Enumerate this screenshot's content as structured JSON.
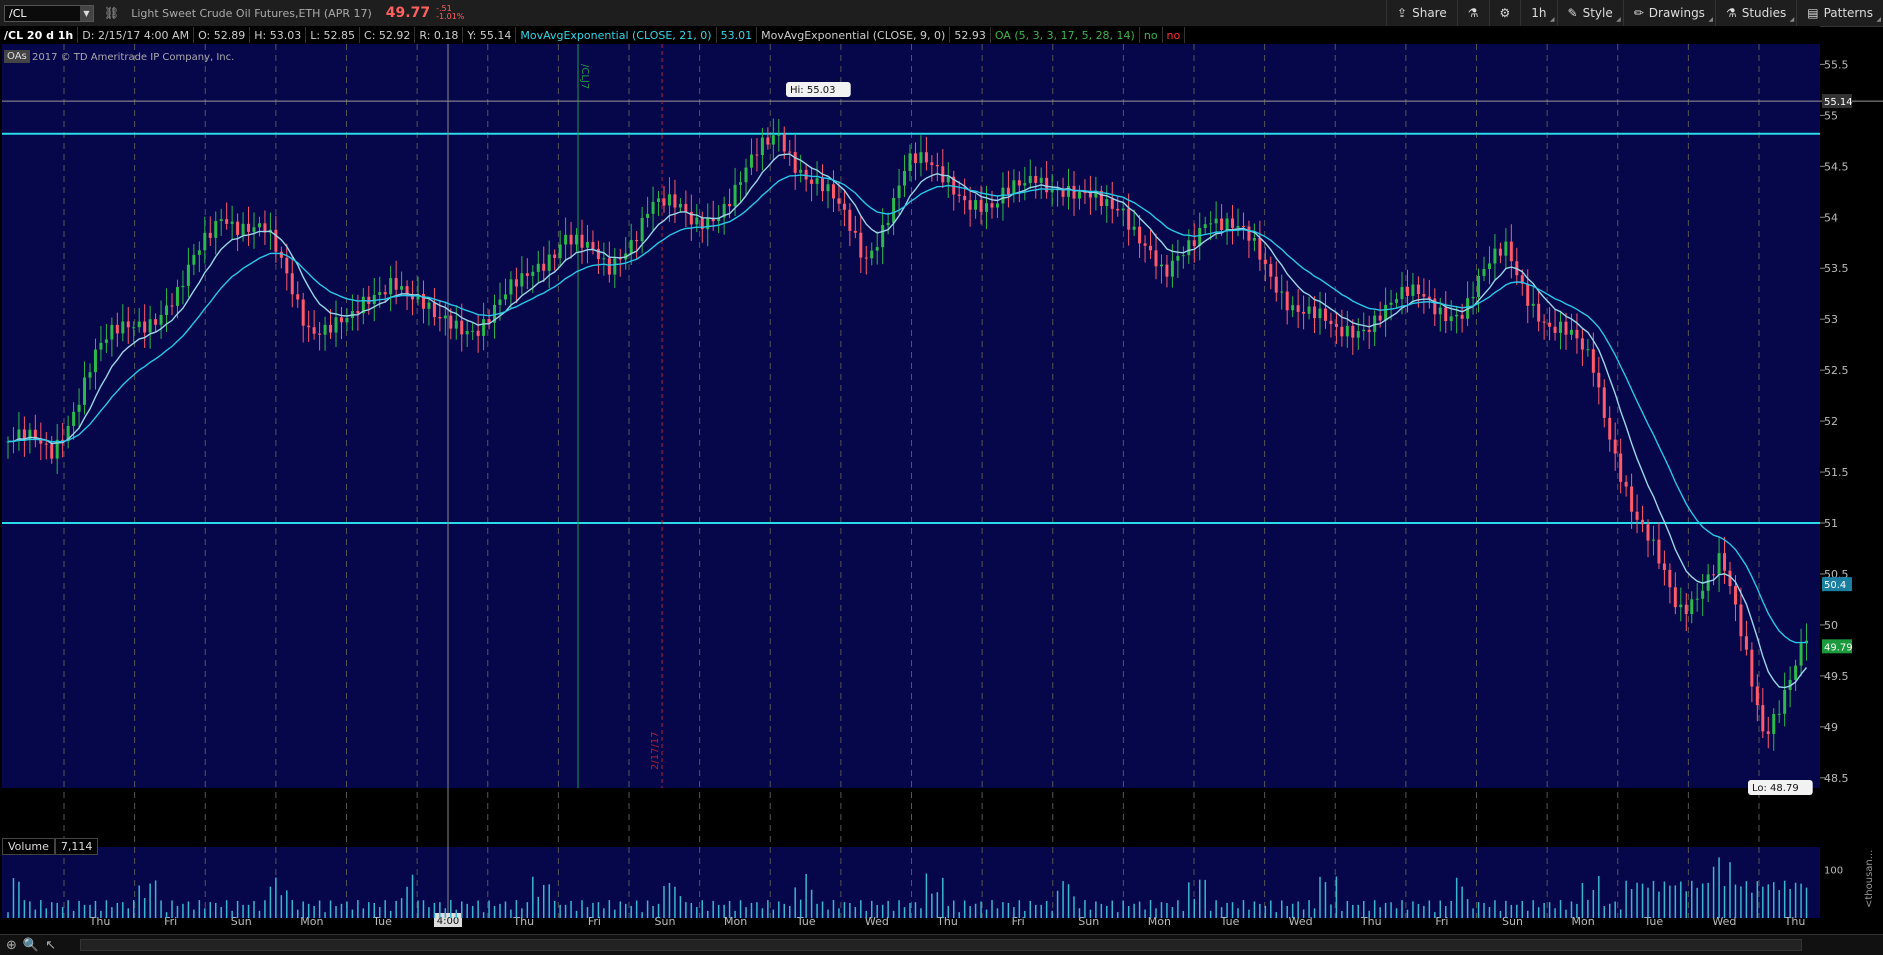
{
  "toolbar": {
    "symbol": "/CL",
    "description": "Light Sweet Crude Oil Futures,ETH (APR 17)",
    "last": "49.77",
    "change": "-.51",
    "change_pct": "-1.01%",
    "buttons": {
      "share": "Share",
      "interval": "1h",
      "style": "Style",
      "drawings": "Drawings",
      "studies": "Studies",
      "patterns": "Patterns"
    }
  },
  "infobar": {
    "title": "/CL 20 d 1h",
    "date": "D: 2/15/17 4:00 AM",
    "open": "O: 52.89",
    "high": "H: 53.03",
    "low": "L: 52.85",
    "close": "C: 52.92",
    "range": "R: 0.18",
    "y": "Y: 55.14",
    "ema21_label": "MovAvgExponential (CLOSE, 21, 0)",
    "ema21_val": "53.01",
    "ema9_label": "MovAvgExponential (CLOSE, 9, 0)",
    "ema9_val": "52.93",
    "oa_label": "OA (5, 3, 3, 17, 5, 28, 14)",
    "oa_no1": "no",
    "oa_no2": "no"
  },
  "overlay": {
    "oas": "OAs",
    "copyright": "2017 © TD Ameritrade IP Company, Inc."
  },
  "volume": {
    "label": "Volume",
    "value": "7,114"
  },
  "colors": {
    "bg": "#06064a",
    "up": "#2db84c",
    "down": "#ff5a6a",
    "ema9": "#9ad6e6",
    "ema21": "#29c6e6",
    "hline": "#29dbe8"
  },
  "chart_data": {
    "type": "candlestick",
    "ylim": [
      48.4,
      55.7
    ],
    "yticks": [
      48.5,
      49,
      49.5,
      50,
      50.5,
      51,
      51.5,
      52,
      52.5,
      53,
      53.5,
      54,
      54.5,
      55,
      55.5
    ],
    "xticks": [
      "Thu",
      "Fri",
      "Sun",
      "Mon",
      "Tue",
      "We",
      "Thu",
      "Fri",
      "Sun",
      "Mon",
      "Tue",
      "Wed",
      "Thu",
      "Fri",
      "Sun",
      "Mon",
      "Tue",
      "Wed",
      "Thu",
      "Fri",
      "Sun",
      "Mon",
      "Tue",
      "Wed",
      "Thu"
    ],
    "cursor_label": "4:00",
    "horizontal_lines": [
      54.82,
      51.0
    ],
    "price_markers": [
      {
        "value": 55.14,
        "label": "55.14"
      },
      {
        "value": 50.4,
        "label": "50.4"
      },
      {
        "value": 49.79,
        "label": "49.79"
      }
    ],
    "annotations": {
      "hi": "Hi: 55.03",
      "lo": "Lo: 48.79",
      "vline1": "/CLJ7",
      "vline2": "2/17/17"
    },
    "close_path": [
      51.8,
      51.7,
      52.6,
      53.0,
      53.2,
      54.1,
      53.8,
      53.0,
      52.9,
      53.5,
      52.9,
      53.0,
      53.3,
      53.9,
      53.4,
      54.2,
      53.9,
      54.3,
      54.8,
      54.3,
      53.6,
      54.5,
      54.4,
      54.0,
      54.5,
      54.1,
      54.2,
      53.3,
      54.1,
      53.7,
      53.2,
      52.8,
      53.1,
      53.2,
      53.1,
      53.7,
      52.9,
      52.6,
      51.0,
      50.2,
      50.6,
      49.0,
      49.8
    ],
    "volume_ylim": [
      0,
      130
    ],
    "volume_yticks": [
      100
    ],
    "volume_unit": "<thousan..."
  }
}
